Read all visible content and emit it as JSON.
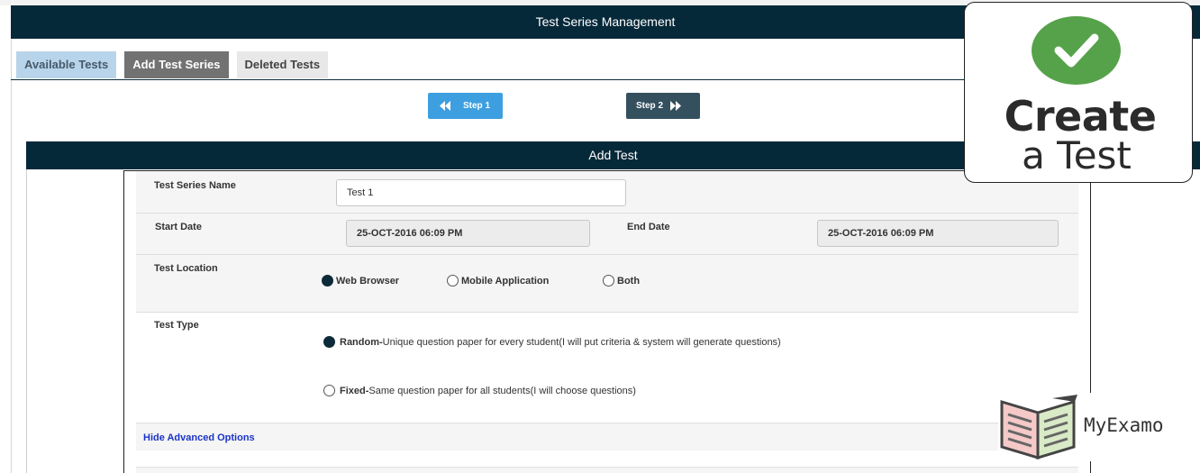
{
  "header": {
    "title": "Test Series Management"
  },
  "tabs": [
    {
      "label": "Available Tests"
    },
    {
      "label": "Add Test Series"
    },
    {
      "label": "Deleted Tests"
    }
  ],
  "steps": {
    "step1": "Step 1",
    "step2": "Step 2"
  },
  "section": {
    "title": "Add Test"
  },
  "form": {
    "series_name": {
      "label": "Test Series Name",
      "value": "Test 1"
    },
    "start_date": {
      "label": "Start Date",
      "value": "25-OCT-2016 06:09 PM"
    },
    "end_date": {
      "label": "End Date",
      "value": "25-OCT-2016 06:09 PM"
    },
    "location": {
      "label": "Test Location",
      "options": [
        "Web Browser",
        "Mobile Application",
        "Both"
      ],
      "selected": "Web Browser"
    },
    "type": {
      "label": "Test Type",
      "random_label": "Random-",
      "random_desc": "Unique question paper for every student(I will put criteria & system will generate questions)",
      "fixed_label": "Fixed-",
      "fixed_desc": "Same question paper for all students(I will choose questions)",
      "selected": "Random"
    },
    "advanced_link": "Hide Advanced Options"
  },
  "logo": {
    "line1": "Create",
    "line2": "a Test",
    "check_color": "#56a24a"
  },
  "brand": {
    "name": "MyExamo"
  },
  "colors": {
    "header": "#06293a",
    "step1": "#3d9fe0",
    "step2": "#34505e",
    "active_tab": "#727272"
  }
}
